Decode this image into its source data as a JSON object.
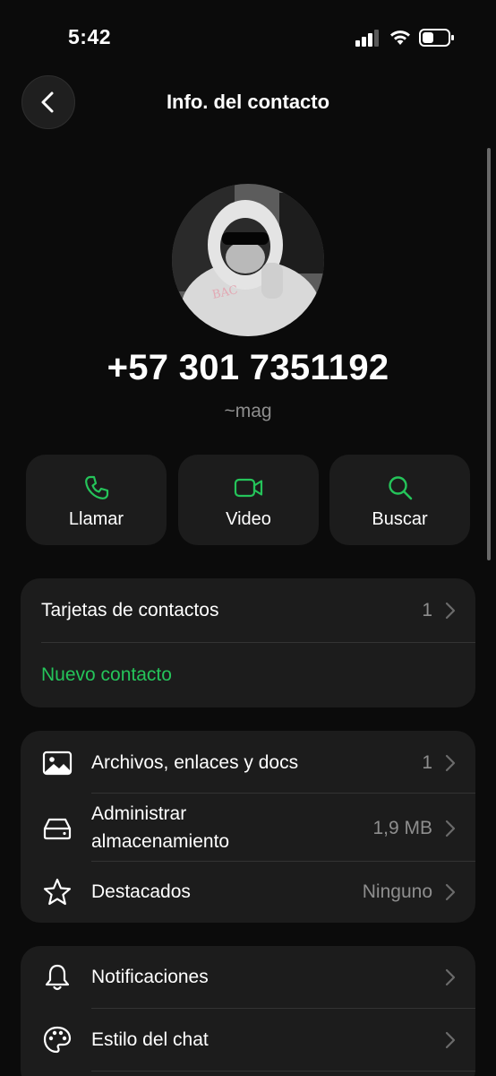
{
  "status_bar": {
    "time": "5:42"
  },
  "header": {
    "title": "Info. del contacto"
  },
  "profile": {
    "phone": "+57 301 7351192",
    "nickname": "~mag"
  },
  "actions": [
    {
      "label": "Llamar",
      "icon": "phone-icon"
    },
    {
      "label": "Video",
      "icon": "video-camera-icon"
    },
    {
      "label": "Buscar",
      "icon": "search-icon"
    }
  ],
  "contact_cards": {
    "label": "Tarjetas de contactos",
    "count": "1",
    "new_contact": "Nuevo contacto"
  },
  "media_section": {
    "files": {
      "label": "Archivos, enlaces y docs",
      "value": "1",
      "icon": "image-icon"
    },
    "storage": {
      "label_line1": "Administrar",
      "label_line2": "almacenamiento",
      "value": "1,9 MB",
      "icon": "storage-drive-icon"
    },
    "starred": {
      "label": "Destacados",
      "value": "Ninguno",
      "icon": "star-icon"
    }
  },
  "settings_section": {
    "notifications": {
      "label": "Notificaciones",
      "icon": "bell-icon"
    },
    "chat_style": {
      "label": "Estilo del chat",
      "icon": "palette-icon"
    }
  },
  "colors": {
    "accent": "#25c45a",
    "background": "#0b0b0b",
    "card": "#1c1c1c",
    "secondary_text": "#8e8e8e"
  }
}
